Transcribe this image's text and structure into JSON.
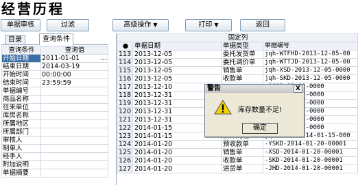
{
  "title": "经营历程",
  "toolbar": {
    "b1": "单据审核",
    "b2": "过滤",
    "b3": "高级操作",
    "b4": "打印",
    "b5": "返回"
  },
  "tabs": [
    "目录",
    "查询条件"
  ],
  "query": {
    "headers": [
      "查询条件",
      "查询值"
    ],
    "rows": [
      {
        "name": "开始日期",
        "value": "2011-01-01"
      },
      {
        "name": "结束日期",
        "value": "2014-03-19"
      },
      {
        "name": "开始时间",
        "value": "00:00:00"
      },
      {
        "name": "结束时间",
        "value": "23:59:59"
      },
      {
        "name": "单据编号",
        "value": ""
      },
      {
        "name": "商品名称",
        "value": ""
      },
      {
        "name": "往来单位",
        "value": ""
      },
      {
        "name": "库房名称",
        "value": ""
      },
      {
        "name": "所属地区",
        "value": ""
      },
      {
        "name": "所属部门",
        "value": ""
      },
      {
        "name": "审核人",
        "value": ""
      },
      {
        "name": "制单人",
        "value": ""
      },
      {
        "name": "经手人",
        "value": ""
      },
      {
        "name": "附加说明",
        "value": ""
      },
      {
        "name": "单据摘要",
        "value": ""
      }
    ],
    "ellipsis": "…"
  },
  "grid": {
    "fixed": "固定列",
    "headers": {
      "idx": "●",
      "date": "单据日期",
      "type": "单据类型",
      "code": "单据编号"
    },
    "rows": [
      {
        "n": "113",
        "date": "2013-12-05",
        "type": "委托发货单",
        "code": "jqh-WTFHD-2013-12-05-00"
      },
      {
        "n": "114",
        "date": "2013-12-05",
        "type": "委托调价单",
        "code": "jqh-WTTJD-2013-12-05-00"
      },
      {
        "n": "115",
        "date": "2013-12-05",
        "type": "销售单",
        "code": "jqh-XSD-2013-12-05-0000"
      },
      {
        "n": "116",
        "date": "2013-12-05",
        "type": "收款单",
        "code": "jqh-SKD-2013-12-05-0000"
      },
      {
        "n": "117",
        "date": "2013-12-10",
        "type": "",
        "code": "-2013-12-10-0000"
      },
      {
        "n": "118",
        "date": "2013-12-31",
        "type": "",
        "code": "-2013-12-31-0000"
      },
      {
        "n": "119",
        "date": "2013-12-31",
        "type": "",
        "code": "-2013-12-31-0000"
      },
      {
        "n": "120",
        "date": "2013-12-31",
        "type": "",
        "code": "-2013-12-31-0000"
      },
      {
        "n": "121",
        "date": "2013-12-31",
        "type": "",
        "code": "-2013-12-31-0000"
      },
      {
        "n": "122",
        "date": "2014-01-15",
        "type": "",
        "code": "-2014-01-15-0000"
      },
      {
        "n": "123",
        "date": "2014-01-15",
        "type": "会计凭证",
        "code": "jqh-KJPZ-2014-01-15-000"
      },
      {
        "n": "124",
        "date": "2014-01-20",
        "type": "预收款单",
        "code": "-YSKD-2014-01-20-00001"
      },
      {
        "n": "125",
        "date": "2014-01-20",
        "type": "销售单",
        "code": "-XSD-2014-01-20-00001"
      },
      {
        "n": "126",
        "date": "2014-01-20",
        "type": "收款单",
        "code": "-SKD-2014-01-20-00001"
      },
      {
        "n": "127",
        "date": "2014-01-20",
        "type": "进货单",
        "code": "-JHD-2014-01-20-00001"
      }
    ]
  },
  "dialog": {
    "title": "警告",
    "close": "X",
    "message": "库存数量不足!",
    "ok": "确定"
  }
}
